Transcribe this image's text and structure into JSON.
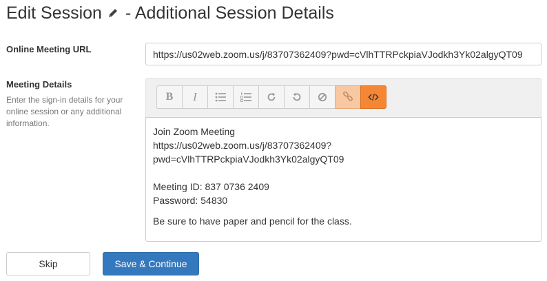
{
  "header": {
    "title_part1": "Edit Session",
    "title_part2": "- Additional Session Details",
    "edit_icon": "pencil-icon"
  },
  "fields": {
    "url": {
      "label": "Online Meeting URL",
      "value": "https://us02web.zoom.us/j/83707362409?pwd=cVlhTTRPckpiaVJodkh3Yk02algyQT09"
    },
    "details": {
      "label": "Meeting Details",
      "help": "Enter the sign-in details for your online session or any additional information."
    }
  },
  "toolbar": {
    "buttons": [
      {
        "name": "bold",
        "glyph": "B",
        "icon": "bold-icon"
      },
      {
        "name": "italic",
        "glyph": "I",
        "icon": "italic-icon"
      },
      {
        "name": "bullet-list",
        "icon": "bullet-list-icon"
      },
      {
        "name": "numbered-list",
        "icon": "numbered-list-icon"
      },
      {
        "name": "redo",
        "icon": "redo-icon"
      },
      {
        "name": "undo",
        "icon": "undo-icon"
      },
      {
        "name": "clear-format",
        "icon": "clear-format-icon"
      },
      {
        "name": "link",
        "icon": "link-icon",
        "active": true
      },
      {
        "name": "code-view",
        "icon": "code-icon",
        "active": true
      }
    ],
    "colors": {
      "link_active": "#f8c8a2",
      "code_active": "#f58634"
    }
  },
  "editor": {
    "line1": "Join Zoom Meeting",
    "line2": "https://us02web.zoom.us/j/83707362409?",
    "line3": "pwd=cVlhTTRPckpiaVJodkh3Yk02algyQT09",
    "line4": "Meeting ID: 837 0736 2409",
    "line5": "Password: 54830",
    "line6": "Be sure to have paper and pencil for the class."
  },
  "actions": {
    "skip_label": "Skip",
    "save_label": "Save & Continue",
    "primary_color": "#3478be"
  }
}
